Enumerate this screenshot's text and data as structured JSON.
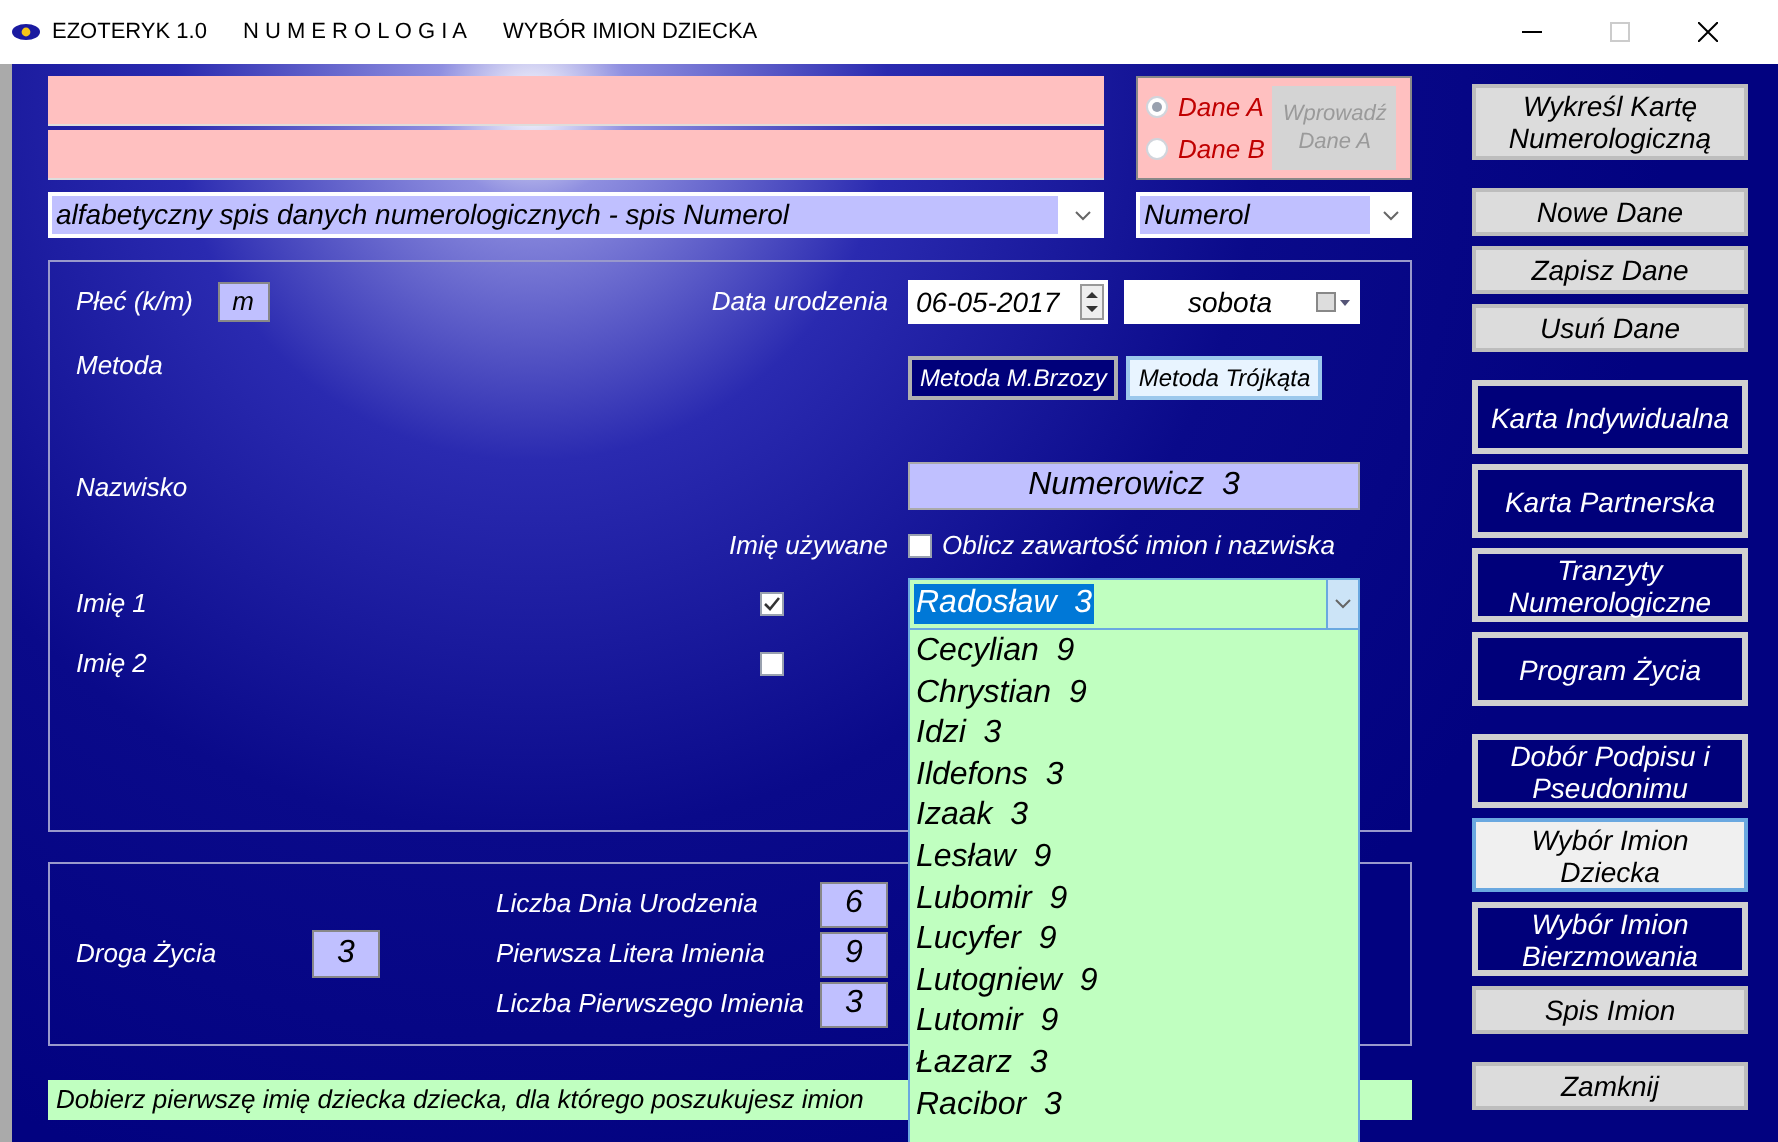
{
  "window": {
    "app": "EZOTERYK 1.0",
    "section": "N U M E R O L O G I A",
    "title": "WYBÓR IMION DZIECKA"
  },
  "data_source": {
    "options": [
      {
        "label": "Dane A",
        "selected": true
      },
      {
        "label": "Dane B",
        "selected": false
      }
    ],
    "button": {
      "label": "Wprowadź Dane A",
      "disabled": true
    }
  },
  "list_combo": {
    "value": "alfabetyczny spis danych numerologicznych - spis Numerol"
  },
  "set_combo": {
    "value": "Numerol"
  },
  "form": {
    "gender_label": "Płeć (k/m)",
    "gender_value": "m",
    "birth_label": "Data urodzenia",
    "birth_date": "06-05-2017",
    "weekday": "sobota",
    "method_label": "Metoda",
    "methods": [
      {
        "label": "Metoda M.Brzozy",
        "selected": true
      },
      {
        "label": "Metoda Trójkąta",
        "selected": false
      }
    ],
    "surname_label": "Nazwisko",
    "surname_value": "Numerowicz  3",
    "used_label": "Imię używane",
    "count_all": {
      "label": "Oblicz zawartość imion i nazwiska",
      "checked": false
    },
    "names": [
      {
        "label": "Imię 1",
        "used": true
      },
      {
        "label": "Imię 2",
        "used": false
      }
    ],
    "name_combo": {
      "value": "Radosław  3",
      "expanded": true,
      "options": [
        "Cecylian  9",
        "Chrystian  9",
        "Idzi  3",
        "Ildefons  3",
        "Izaak  3",
        "Lesław  9",
        "Lubomir  9",
        "Lucyfer  9",
        "Lutogniew  9",
        "Lutomir  9",
        "Łazarz  3",
        "Racibor  3"
      ]
    }
  },
  "results": {
    "life_path_label": "Droga Życia",
    "life_path": "3",
    "rows": [
      {
        "label": "Liczba Dnia Urodzenia",
        "value": "6"
      },
      {
        "label": "Pierwsza Litera Imienia",
        "value": "9"
      },
      {
        "label": "Liczba Pierwszego Imienia",
        "value": "3"
      }
    ]
  },
  "hint": "Dobierz pierwszę imię dziecka dziecka, dla którego poszukujesz imion",
  "side_groups": [
    {
      "buttons": [
        {
          "kind": "gray",
          "label": "Wykreśl Kartę Numerologiczną"
        }
      ]
    },
    {
      "buttons": [
        {
          "kind": "gray",
          "label": "Nowe Dane"
        },
        {
          "kind": "gray",
          "label": "Zapisz Dane"
        },
        {
          "kind": "gray",
          "label": "Usuń Dane"
        }
      ]
    },
    {
      "buttons": [
        {
          "kind": "nav",
          "label": "Karta Indywidualna",
          "selected": false
        },
        {
          "kind": "nav",
          "label": "Karta Partnerska",
          "selected": false
        },
        {
          "kind": "nav",
          "label": "Tranzyty Numerologiczne",
          "selected": false
        },
        {
          "kind": "nav",
          "label": "Program Życia",
          "selected": false
        }
      ]
    },
    {
      "buttons": [
        {
          "kind": "nav",
          "label": "Dobór Podpisu i Pseudonimu",
          "selected": false
        },
        {
          "kind": "nav",
          "label": "Wybór Imion Dziecka",
          "selected": true
        },
        {
          "kind": "nav",
          "label": "Wybór Imion Bierzmowania",
          "selected": false
        },
        {
          "kind": "gray",
          "label": "Spis Imion"
        }
      ]
    },
    {
      "buttons": [
        {
          "kind": "gray",
          "label": "Zamknij"
        }
      ]
    }
  ]
}
